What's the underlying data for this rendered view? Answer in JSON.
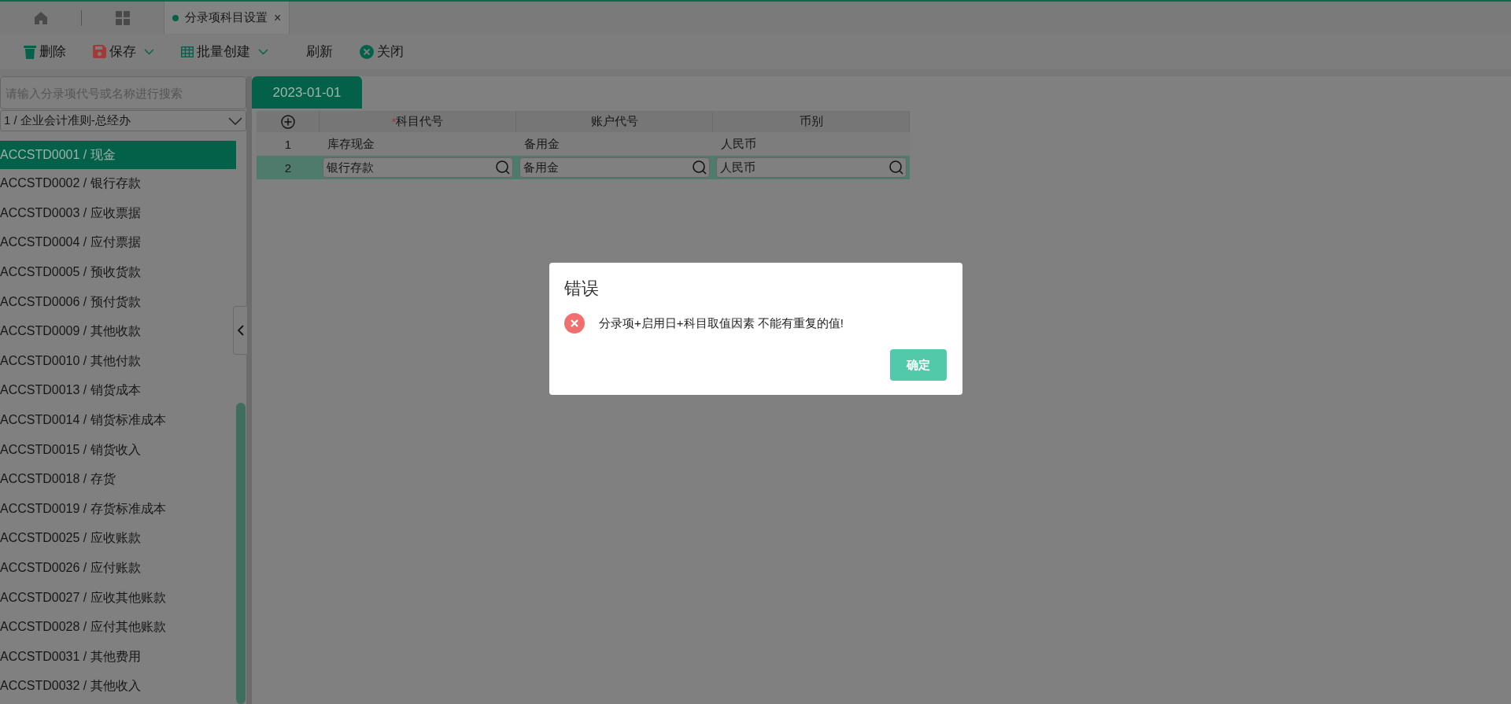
{
  "tab_bar": {
    "tabs": [
      {
        "label": "分录项科目设置",
        "selected": true,
        "close": "×"
      }
    ]
  },
  "toolbar": {
    "buttons": [
      {
        "label": "删除",
        "kind": "trash",
        "dropdown": false
      },
      {
        "label": "保存",
        "kind": "save",
        "dropdown": true
      },
      {
        "label": "批量创建",
        "kind": "table",
        "dropdown": true
      },
      {
        "label": "刷新",
        "kind": "none",
        "dropdown": false
      },
      {
        "label": "关闭",
        "kind": "close",
        "dropdown": false
      }
    ]
  },
  "sidebar": {
    "search": {
      "placeholder": "请输入分录项代号或名称进行搜索"
    },
    "ledger_select": {
      "value": "1 / 企业会计准则-总经办"
    },
    "items": [
      {
        "label": "ACCSTD0001 / 现金",
        "selected": true
      },
      {
        "label": "ACCSTD0002 / 银行存款",
        "selected": false
      },
      {
        "label": "ACCSTD0003 / 应收票据",
        "selected": false
      },
      {
        "label": "ACCSTD0004 / 应付票据",
        "selected": false
      },
      {
        "label": "ACCSTD0005 / 预收货款",
        "selected": false
      },
      {
        "label": "ACCSTD0006 / 预付货款",
        "selected": false
      },
      {
        "label": "ACCSTD0009 / 其他收款",
        "selected": false
      },
      {
        "label": "ACCSTD0010 / 其他付款",
        "selected": false
      },
      {
        "label": "ACCSTD0013 / 销货成本",
        "selected": false
      },
      {
        "label": "ACCSTD0014 / 销货标准成本",
        "selected": false
      },
      {
        "label": "ACCSTD0015 / 销货收入",
        "selected": false
      },
      {
        "label": "ACCSTD0018 / 存货",
        "selected": false
      },
      {
        "label": "ACCSTD0019 / 存货标准成本",
        "selected": false
      },
      {
        "label": "ACCSTD0025 / 应收账款",
        "selected": false
      },
      {
        "label": "ACCSTD0026 / 应付账款",
        "selected": false
      },
      {
        "label": "ACCSTD0027 / 应收其他账款",
        "selected": false
      },
      {
        "label": "ACCSTD0028 / 应付其他账款",
        "selected": false
      },
      {
        "label": "ACCSTD0031 / 其他费用",
        "selected": false
      },
      {
        "label": "ACCSTD0032 / 其他收入",
        "selected": false
      }
    ]
  },
  "date_tabs": [
    {
      "label": "2023-01-01",
      "selected": true
    }
  ],
  "grid": {
    "columns": [
      {
        "label": "科目代号",
        "required_mark": "*"
      },
      {
        "label": "账户代号"
      },
      {
        "label": "币别"
      }
    ],
    "rows": [
      {
        "number": "1",
        "selected": false,
        "cells": [
          "库存现金",
          "备用金",
          "人民币"
        ]
      },
      {
        "number": "2",
        "selected": true,
        "cells": [
          "银行存款",
          "备用金",
          "人民币"
        ]
      }
    ]
  },
  "dialog": {
    "title": "错误",
    "message": "分录项+启用日+科目取值因素 不能有重复的值!",
    "button": "确定"
  }
}
